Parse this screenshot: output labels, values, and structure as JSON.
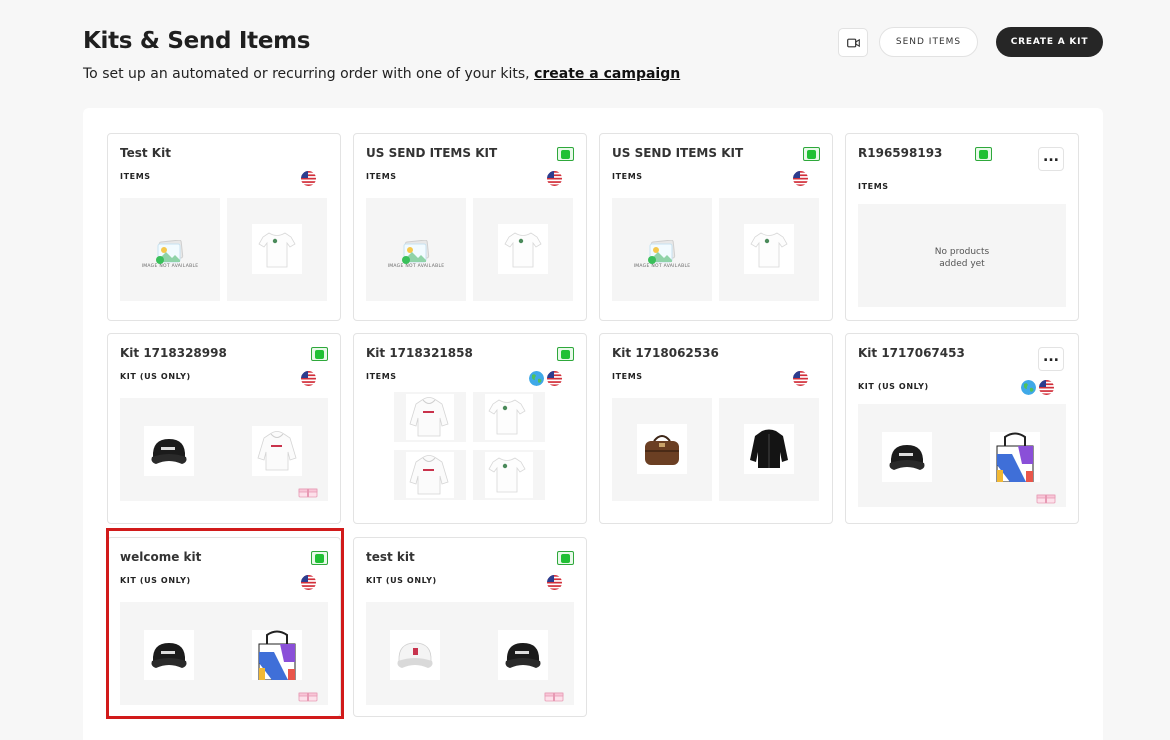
{
  "header": {
    "title": "Kits & Send Items",
    "subtitle_prefix": "To set up an automated or recurring order with one of your kits, ",
    "subtitle_link": "create a campaign",
    "send_items_label": "SEND ITEMS",
    "create_kit_label": "CREATE A KIT"
  },
  "image_not_available": "IMAGE NOT AVAILABLE",
  "no_products_line1": "No products",
  "no_products_line2": "added yet",
  "kits": [
    {
      "name": "Test Kit",
      "type": "ITEMS",
      "status": "none",
      "regions": [
        "us"
      ],
      "products": [
        "image-not-available",
        "white-tshirt"
      ]
    },
    {
      "name": "US SEND ITEMS KIT",
      "type": "ITEMS",
      "status": "active",
      "regions": [
        "us"
      ],
      "products": [
        "image-not-available",
        "white-tshirt"
      ]
    },
    {
      "name": "US SEND ITEMS KIT",
      "type": "ITEMS",
      "status": "active",
      "regions": [
        "us"
      ],
      "products": [
        "image-not-available",
        "white-tshirt"
      ]
    },
    {
      "name": "R196598193",
      "type": "ITEMS",
      "status": "active",
      "regions": [],
      "products": []
    },
    {
      "name": "Kit 1718328998",
      "type": "KIT (US ONLY)",
      "status": "active",
      "regions": [
        "us"
      ],
      "products": [
        "black-cap",
        "white-hoodie"
      ]
    },
    {
      "name": "Kit 1718321858",
      "type": "ITEMS",
      "status": "active",
      "regions": [
        "globe",
        "us"
      ],
      "products": [
        "white-hoodie",
        "white-tshirt",
        "white-hoodie",
        "white-tshirt"
      ]
    },
    {
      "name": "Kit 1718062536",
      "type": "ITEMS",
      "status": "none",
      "regions": [
        "us"
      ],
      "products": [
        "leather-duffel-bag",
        "black-jacket"
      ]
    },
    {
      "name": "Kit 1717067453",
      "type": "KIT (US ONLY)",
      "status": "none",
      "regions": [
        "globe",
        "us"
      ],
      "products": [
        "black-cap",
        "tote-bag"
      ]
    },
    {
      "name": "welcome kit",
      "type": "KIT (US ONLY)",
      "status": "active",
      "regions": [
        "us"
      ],
      "products": [
        "black-cap",
        "tote-bag"
      ]
    },
    {
      "name": "test kit",
      "type": "KIT (US ONLY)",
      "status": "active",
      "regions": [
        "us"
      ],
      "products": [
        "white-cap",
        "black-cap"
      ]
    }
  ],
  "colors": {
    "accent_dark": "#262626",
    "active_green": "#20c034",
    "highlight_red": "#d11a1a"
  }
}
